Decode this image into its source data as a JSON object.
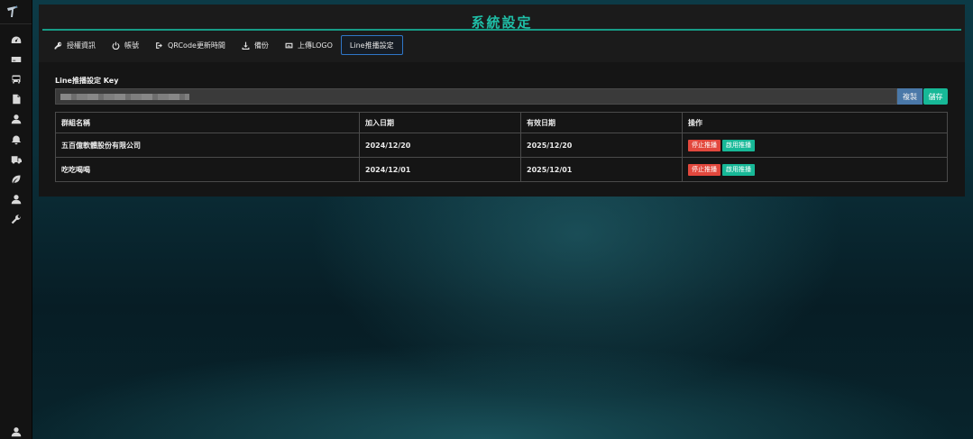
{
  "sidebar": {
    "icons": [
      "dashboard-icon",
      "card-icon",
      "bus-icon",
      "document-icon",
      "user-icon",
      "bell-icon",
      "truck-icon",
      "leaf-icon",
      "user-icon",
      "wrench-icon"
    ],
    "bottom_icon": "user-icon"
  },
  "page": {
    "title": "系統設定"
  },
  "tabs": [
    {
      "label": "授權資訊",
      "icon": "key-icon"
    },
    {
      "label": "帳號",
      "icon": "power-icon"
    },
    {
      "label": "QRCode更新時間",
      "icon": "sign-out-icon"
    },
    {
      "label": "備份",
      "icon": "download-icon"
    },
    {
      "label": "上傳LOGO",
      "icon": "image-icon"
    },
    {
      "label": "Line推播設定",
      "icon": ""
    }
  ],
  "line_settings": {
    "key_label": "Line推播設定 Key",
    "copy_label": "複製",
    "save_label": "儲存"
  },
  "table": {
    "headers": [
      "群組名稱",
      "加入日期",
      "有效日期",
      "操作"
    ],
    "rows": [
      {
        "name": "五百億軟體股份有限公司",
        "joined": "2024/12/20",
        "valid": "2025/12/20",
        "stop": "停止推播",
        "start": "啟用推播"
      },
      {
        "name": "吃吃喝喝",
        "joined": "2024/12/01",
        "valid": "2025/12/01",
        "stop": "停止推播",
        "start": "啟用推播"
      }
    ]
  },
  "colors": {
    "accent": "#1fbfa7",
    "copy_button": "#4a78a8",
    "save_button": "#17b897",
    "stop_button": "#e2483d",
    "start_button": "#17b897",
    "active_tab_border": "#2f76c7"
  }
}
